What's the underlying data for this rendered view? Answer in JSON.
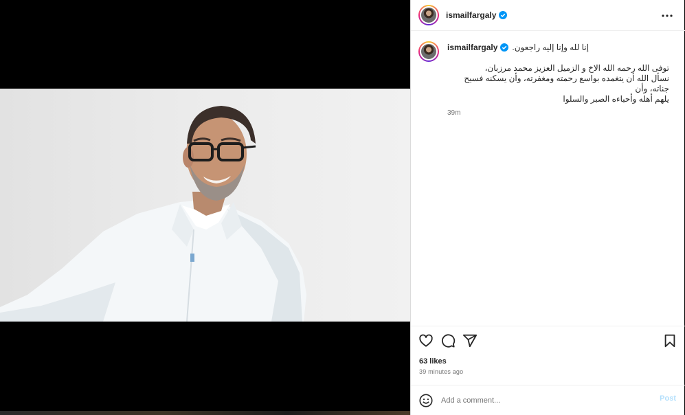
{
  "post": {
    "author": "ismailfargaly",
    "verified": true,
    "caption_first_line": "إنا لله وإنا إليه راجعون.",
    "caption_lines": [
      "توفى الله رحمه الله الاخ و الزميل العزيز محمد مرزبان،",
      "نسأل الله أن يتغمده بواسع رحمته ومغفرته، وأن يسكنه فسيح جناته، وأن",
      "يلهم أهله وأحباءه الصبر والسلوا"
    ],
    "caption_time": "39m",
    "likes": "63 likes",
    "posted_ago": "39 minutes ago"
  },
  "comment": {
    "placeholder": "Add a comment...",
    "post_label": "Post"
  },
  "icons": {
    "verified": "verified-badge-icon",
    "more": "more-options-icon",
    "like": "heart-icon",
    "comment": "comment-icon",
    "share": "share-icon",
    "save": "bookmark-icon",
    "emoji": "emoji-icon"
  },
  "colors": {
    "verified_blue": "#0095f6",
    "post_button": "#b2dffc",
    "text_primary": "#262626",
    "text_secondary": "#737373"
  }
}
